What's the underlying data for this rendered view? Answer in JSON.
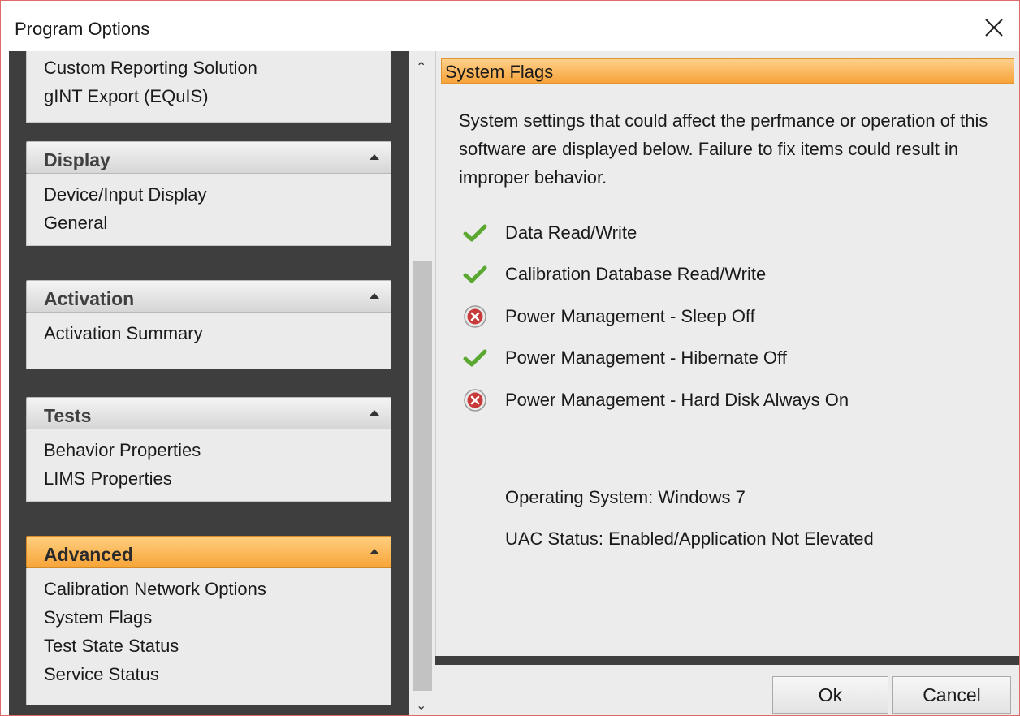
{
  "window": {
    "title": "Program Options"
  },
  "nav": {
    "top_items": [
      "Custom Reporting Solution",
      "gINT Export (EQuIS)"
    ],
    "groups": [
      {
        "title": "Display",
        "items": [
          "Device/Input Display",
          "General"
        ]
      },
      {
        "title": "Activation",
        "items": [
          "Activation Summary"
        ]
      },
      {
        "title": "Tests",
        "items": [
          "Behavior Properties",
          "LIMS Properties"
        ]
      },
      {
        "title": "Advanced",
        "items": [
          "Calibration Network Options",
          "System Flags",
          "Test State Status",
          "Service Status"
        ]
      }
    ]
  },
  "content": {
    "header": "System Flags",
    "description": "System settings that could affect the perfmance or operation of this software are displayed below.  Failure to fix items could result in improper behavior.",
    "flags": [
      {
        "label": "Data Read/Write",
        "status": "ok"
      },
      {
        "label": "Calibration Database Read/Write",
        "status": "ok"
      },
      {
        "label": "Power Management - Sleep Off",
        "status": "error"
      },
      {
        "label": "Power Management - Hibernate Off",
        "status": "ok"
      },
      {
        "label": "Power Management - Hard Disk Always On",
        "status": "error"
      }
    ],
    "os_label": "Operating System:  Windows 7",
    "uac_label": "UAC Status:  Enabled/Application Not Elevated"
  },
  "buttons": {
    "ok": "Ok",
    "cancel": "Cancel"
  },
  "colors": {
    "accent": "#f7a437",
    "check": "#5aa832",
    "error": "#c83a3a"
  }
}
